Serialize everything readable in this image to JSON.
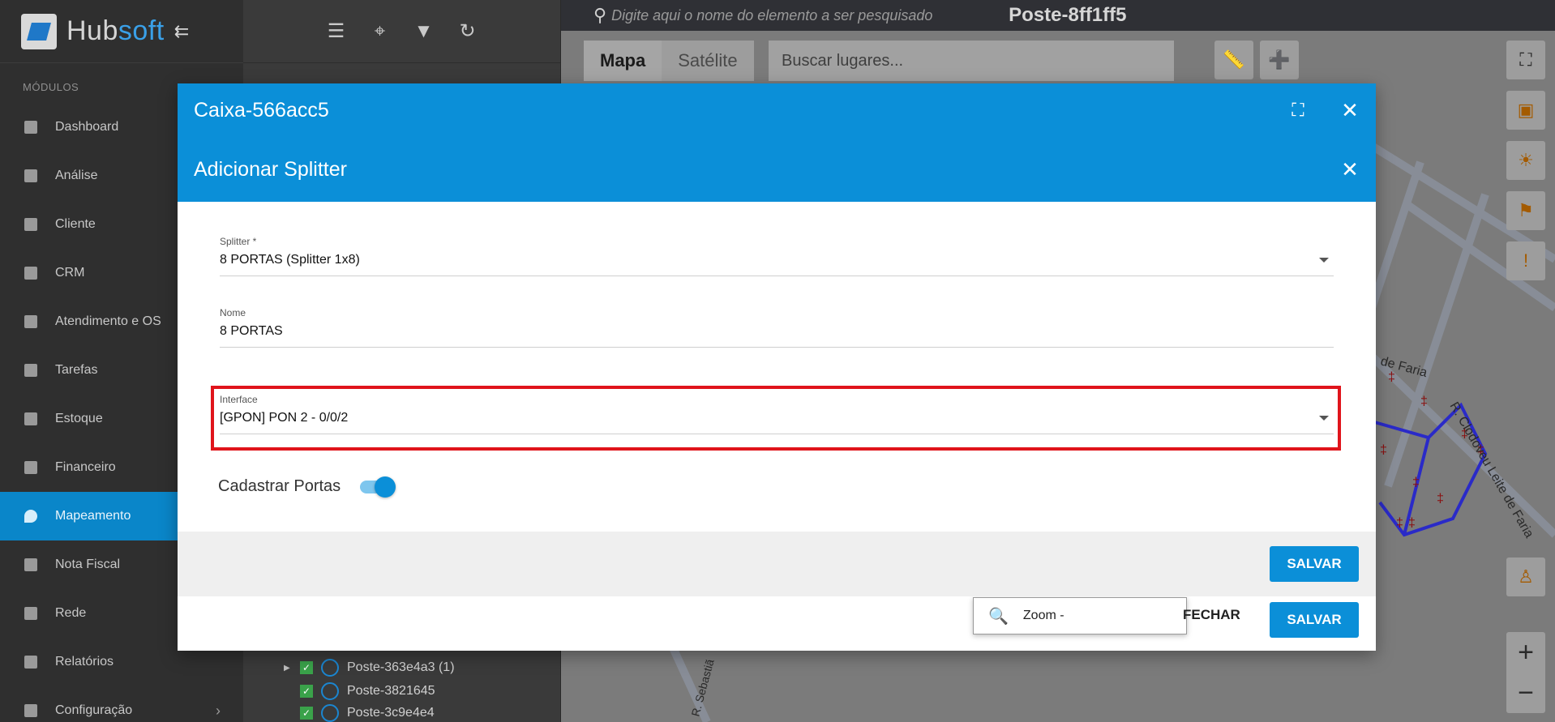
{
  "sidebar": {
    "brand_hub": "Hub",
    "brand_soft": "soft",
    "collapse_icon": "⇇",
    "section_label": "MÓDULOS",
    "items": [
      {
        "label": "Dashboard",
        "icon": "dashboard-icon"
      },
      {
        "label": "Análise",
        "icon": "pie-chart-icon"
      },
      {
        "label": "Cliente",
        "icon": "contact-card-icon"
      },
      {
        "label": "CRM",
        "icon": "board-icon"
      },
      {
        "label": "Atendimento e OS",
        "icon": "calendar-clock-icon"
      },
      {
        "label": "Tarefas",
        "icon": "clipboard-icon"
      },
      {
        "label": "Estoque",
        "icon": "box-icon"
      },
      {
        "label": "Financeiro",
        "icon": "money-icon"
      },
      {
        "label": "Mapeamento",
        "icon": "map-pin-icon",
        "active": true
      },
      {
        "label": "Nota Fiscal",
        "icon": "receipt-icon"
      },
      {
        "label": "Rede",
        "icon": "server-icon"
      },
      {
        "label": "Relatórios",
        "icon": "report-icon"
      },
      {
        "label": "Configuração",
        "icon": "gear-icon",
        "chevron": "›"
      }
    ]
  },
  "tree": {
    "toolbar_icons": [
      "menu-icon",
      "map-marker-icon",
      "filter-icon",
      "refresh-icon"
    ],
    "rows": [
      {
        "label": "Poste-363e4a3 (1)",
        "caret": true
      },
      {
        "label": "Poste-3821645",
        "caret": false
      },
      {
        "label": "Poste-3c9e4e4",
        "caret": false
      }
    ]
  },
  "map": {
    "search_placeholder": "Digite aqui o nome do elemento a ser pesquisado",
    "title": "Poste-8ff1ff5",
    "tab_map": "Mapa",
    "tab_satellite": "Satélite",
    "places_placeholder": "Buscar lugares...",
    "street_labels": [
      "de Faria",
      "R. Clodoveu Leite de Faria",
      "R. Sebastiã"
    ],
    "zoom_in": "+",
    "zoom_out": "−"
  },
  "outer_dialog": {
    "title": "Caixa-566acc5",
    "maximize_icon": "⛶",
    "close_icon": "✕",
    "close_label": "FECHAR",
    "save_label": "SALVAR",
    "zoom_label": "Zoom -"
  },
  "inner_dialog": {
    "title": "Adicionar Splitter",
    "close_icon": "✕",
    "fields": {
      "splitter": {
        "label": "Splitter *",
        "value": "8 PORTAS (Splitter 1x8)"
      },
      "nome": {
        "label": "Nome",
        "value": "8 PORTAS"
      },
      "interface": {
        "label": "Interface",
        "value": "[GPON] PON 2 - 0/0/2"
      }
    },
    "toggle_label": "Cadastrar Portas",
    "toggle_on": true,
    "save_label": "SALVAR",
    "highlight_color": "#e0141b"
  },
  "colors": {
    "accent": "#0b8fd8",
    "sidebar_bg": "#2f2f2f",
    "active_nav": "#0a86c9"
  }
}
